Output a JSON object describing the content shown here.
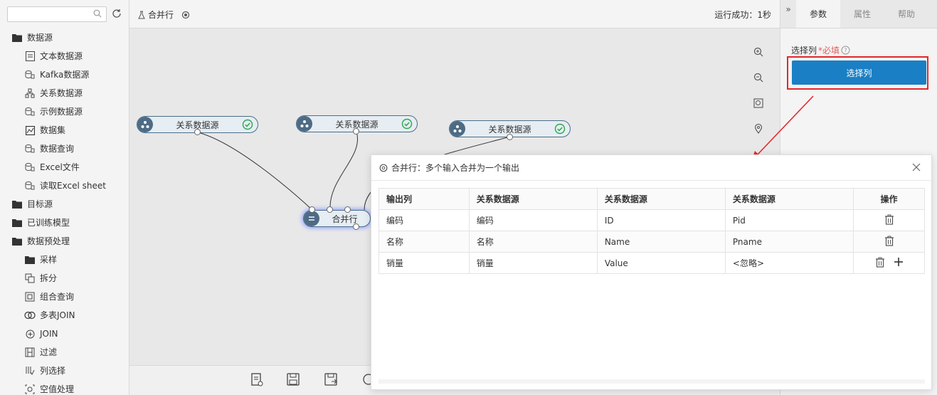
{
  "sidebar": {
    "search_placeholder": "",
    "items": [
      {
        "label": "数据源",
        "level": 0,
        "icon": "folder-icon"
      },
      {
        "label": "文本数据源",
        "level": 1,
        "icon": "text-file-icon"
      },
      {
        "label": "Kafka数据源",
        "level": 1,
        "icon": "database-icon"
      },
      {
        "label": "关系数据源",
        "level": 1,
        "icon": "relation-icon"
      },
      {
        "label": "示例数据源",
        "level": 1,
        "icon": "database-icon"
      },
      {
        "label": "数据集",
        "level": 1,
        "icon": "dataset-icon"
      },
      {
        "label": "数据查询",
        "level": 1,
        "icon": "database-icon"
      },
      {
        "label": "Excel文件",
        "level": 1,
        "icon": "database-icon"
      },
      {
        "label": "读取Excel sheet",
        "level": 1,
        "icon": "database-icon"
      },
      {
        "label": "目标源",
        "level": 0,
        "icon": "folder-icon"
      },
      {
        "label": "已训练模型",
        "level": 0,
        "icon": "folder-icon"
      },
      {
        "label": "数据预处理",
        "level": 0,
        "icon": "folder-icon"
      },
      {
        "label": "采样",
        "level": 1,
        "icon": "folder-icon"
      },
      {
        "label": "拆分",
        "level": 1,
        "icon": "split-icon"
      },
      {
        "label": "组合查询",
        "level": 1,
        "icon": "combine-icon"
      },
      {
        "label": "多表JOIN",
        "level": 1,
        "icon": "join-icon"
      },
      {
        "label": "JOIN",
        "level": 1,
        "icon": "plus-circle-icon"
      },
      {
        "label": "过滤",
        "level": 1,
        "icon": "filter-icon"
      },
      {
        "label": "列选择",
        "level": 1,
        "icon": "column-select-icon"
      },
      {
        "label": "空值处理",
        "level": 1,
        "icon": "null-handle-icon"
      }
    ]
  },
  "canvas": {
    "title": "合并行",
    "status": "运行成功：1秒",
    "nodes": [
      {
        "label": "关系数据源"
      },
      {
        "label": "关系数据源"
      },
      {
        "label": "关系数据源"
      },
      {
        "label": "合并行"
      }
    ]
  },
  "right_panel": {
    "tabs": [
      "参数",
      "属性",
      "帮助"
    ],
    "field_label": "选择列",
    "required_text": "*必填",
    "button_label": "选择列"
  },
  "dialog": {
    "title": "合并行：多个输入合并为一个输出",
    "headers": [
      "输出列",
      "关系数据源",
      "关系数据源",
      "关系数据源",
      "操作"
    ],
    "rows": [
      [
        "编码",
        "编码",
        "ID",
        "Pid"
      ],
      [
        "名称",
        "名称",
        "Name",
        "Pname"
      ],
      [
        "销量",
        "销量",
        "Value",
        "<忽略>"
      ]
    ]
  },
  "colors": {
    "primary_button": "#1a7fc4",
    "highlight_red": "#e5262a",
    "node_icon": "#4e6b85",
    "success_green": "#2aa84a"
  }
}
